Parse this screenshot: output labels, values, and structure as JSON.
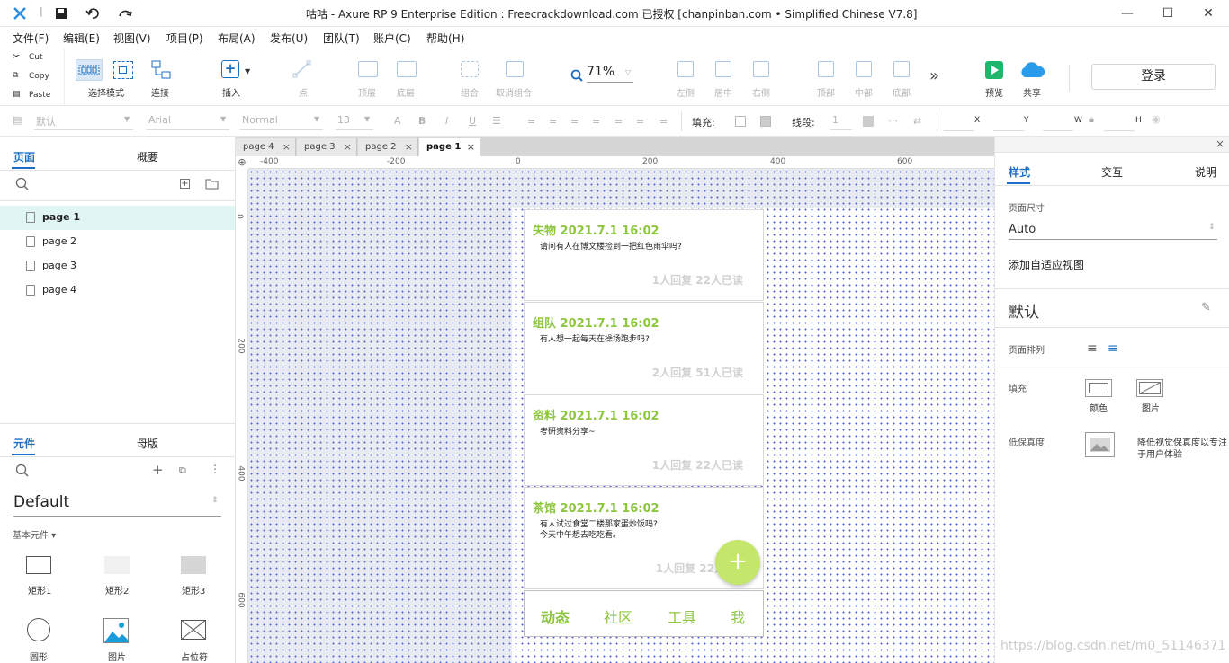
{
  "window": {
    "title": "咕咕 - Axure RP 9 Enterprise Edition : Freecrackdownload.com 已授权     [chanpinban.com • Simplified Chinese V7.8]",
    "minimize": "—",
    "maximize": "☐",
    "close": "✕"
  },
  "menu": [
    "文件(F)",
    "编辑(E)",
    "视图(V)",
    "项目(P)",
    "布局(A)",
    "发布(U)",
    "团队(T)",
    "账户(C)",
    "帮助(H)"
  ],
  "clipboard": {
    "cut": "Cut",
    "copy": "Copy",
    "paste": "Paste"
  },
  "toolbar": {
    "select_mode": "选择模式",
    "connect": "连接",
    "insert": "插入",
    "point": "点",
    "top_layer": "顶层",
    "bottom_layer": "底层",
    "group": "组合",
    "ungroup": "取消组合",
    "zoom": "71%",
    "align_left": "左侧",
    "align_center": "居中",
    "align_right": "右侧",
    "align_top": "顶部",
    "align_middle": "中部",
    "align_bottom": "底部",
    "more": "»",
    "preview": "预览",
    "share": "共享",
    "login": "登录"
  },
  "format": {
    "style": "默认",
    "font": "Arial",
    "weight": "Normal",
    "size": "13",
    "fill_label": "填充:",
    "stroke_label": "线段:",
    "stroke_value": "1",
    "x": "X",
    "y": "Y",
    "w": "W",
    "h": "H"
  },
  "left": {
    "tab_pages": "页面",
    "tab_outline": "概要",
    "pages": [
      "page 1",
      "page 2",
      "page 3",
      "page 4"
    ],
    "tab_widgets": "元件",
    "tab_masters": "母版",
    "library": "Default",
    "category": "基本元件 ▾",
    "widgets": [
      "矩形1",
      "矩形2",
      "矩形3",
      "圆形",
      "图片",
      "占位符"
    ]
  },
  "tabs": [
    "page 4",
    "page 3",
    "page 2",
    "page 1"
  ],
  "ruler": {
    "h": [
      "-400",
      "-200",
      "0",
      "200",
      "400",
      "600"
    ],
    "v": [
      "0",
      "200",
      "400",
      "600"
    ]
  },
  "mobile": {
    "cards": [
      {
        "title": "失物 2021.7.1 16:02",
        "body": "请问有人在博文楼捡到一把红色雨伞吗?",
        "stats": "1人回复 22人已读"
      },
      {
        "title": "组队 2021.7.1 16:02",
        "body": "有人想一起每天在操场跑步吗?",
        "stats": "2人回复 51人已读"
      },
      {
        "title": "资料 2021.7.1 16:02",
        "body": "考研资料分享~",
        "stats": "1人回复 22人已读"
      },
      {
        "title": "茶馆 2021.7.1 16:02",
        "body": "有人试过食堂二楼那家蛋炒饭吗?",
        "body2": "今天中午想去吃吃看。",
        "stats": "1人回复 22人"
      }
    ],
    "fab": "+",
    "nav": [
      "动态",
      "社区",
      "工具",
      "我"
    ]
  },
  "right": {
    "tabs": [
      "样式",
      "交互",
      "说明"
    ],
    "page_size_label": "页面尺寸",
    "page_size_value": "Auto",
    "adaptive_link": "添加自适应视图",
    "style_name": "默认",
    "arrange_label": "页面排列",
    "fill_label": "填充",
    "fill_color": "颜色",
    "fill_image": "图片",
    "lowfi_label": "低保真度",
    "lowfi_desc1": "降低视觉保真度以专注",
    "lowfi_desc2": "于用户体验"
  },
  "watermark": "https://blog.csdn.net/m0_51146371",
  "colors": {
    "accent": "#1a6fc4",
    "green": "#8dc63f",
    "fab": "#c4e66a",
    "nav_active": "#8dc63f"
  }
}
